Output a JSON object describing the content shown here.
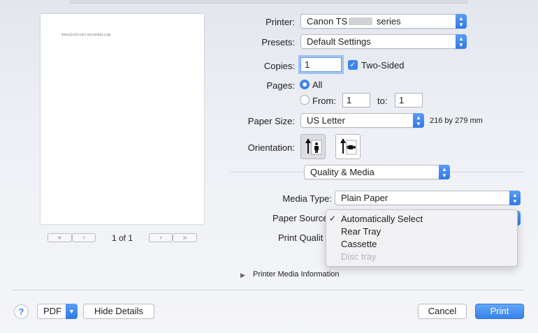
{
  "preview": {
    "doc_text": "dhdjdjsdjsjdclsdjshhbdjsjdp",
    "page_indicator": "1 of 1",
    "first_page": "«",
    "prev_page": "‹",
    "next_page": "›",
    "last_page": "»"
  },
  "printer": {
    "label": "Printer:",
    "value": "Canon TS",
    "value_suffix": "series"
  },
  "presets": {
    "label": "Presets:",
    "value": "Default Settings"
  },
  "copies": {
    "label": "Copies:",
    "value": "1",
    "two_sided_label": "Two-Sided",
    "two_sided_checked": true
  },
  "pages": {
    "label": "Pages:",
    "all_label": "All",
    "from_label": "From:",
    "from_value": "1",
    "to_label": "to:",
    "to_value": "1",
    "selected": "All"
  },
  "paper_size": {
    "label": "Paper Size:",
    "value": "US Letter",
    "dimensions": "216 by 279 mm"
  },
  "orientation": {
    "label": "Orientation:",
    "options": [
      "portrait",
      "landscape"
    ],
    "selected": "portrait"
  },
  "section": {
    "value": "Quality & Media"
  },
  "media_type": {
    "label": "Media Type:",
    "value": "Plain Paper"
  },
  "paper_source": {
    "label": "Paper Source",
    "menu": [
      {
        "label": "Automatically Select",
        "checked": true,
        "enabled": true
      },
      {
        "label": "Rear Tray",
        "checked": false,
        "enabled": true
      },
      {
        "label": "Cassette",
        "checked": false,
        "enabled": true
      },
      {
        "label": "Disc tray",
        "checked": false,
        "enabled": false
      }
    ]
  },
  "print_quality": {
    "label": "Print Qualit"
  },
  "media_info": {
    "label": "Printer Media Information"
  },
  "footer": {
    "help": "?",
    "pdf": "PDF",
    "hide_details": "Hide Details",
    "cancel": "Cancel",
    "print": "Print"
  },
  "colors": {
    "accent": "#3b84ec",
    "menu_bg": "#f1f1f3",
    "disabled_text": "#b4b5b9"
  }
}
